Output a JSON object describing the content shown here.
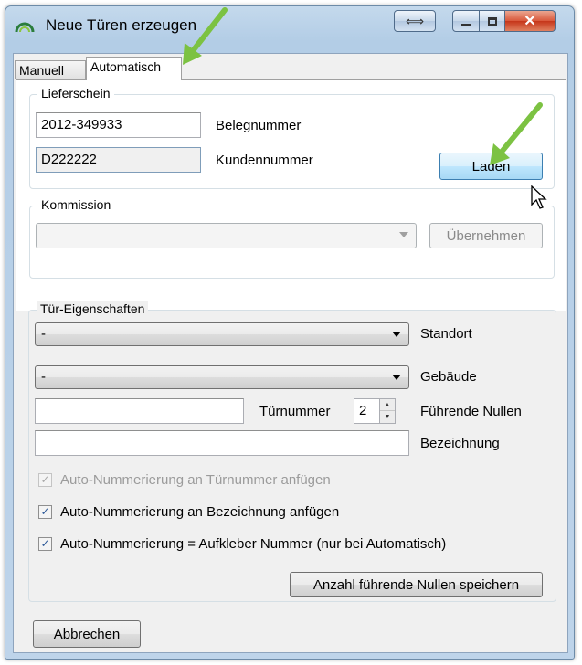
{
  "window": {
    "title": "Neue Türen erzeugen"
  },
  "tabs": [
    {
      "label": "Manuell",
      "selected": false
    },
    {
      "label": "Automatisch",
      "selected": true
    }
  ],
  "lieferschein": {
    "legend": "Lieferschein",
    "beleg_value": "2012-349933",
    "beleg_label": "Belegnummer",
    "kunden_value": "D222222",
    "kunden_label": "Kundennummer",
    "load_button": "Laden"
  },
  "kommission": {
    "legend": "Kommission",
    "selected": "",
    "apply_button": "Übernehmen"
  },
  "tuer": {
    "legend": "Tür-Eigenschaften",
    "standort_value": "-",
    "standort_label": "Standort",
    "gebaeude_value": "-",
    "gebaeude_label": "Gebäude",
    "tuernummer_value": "",
    "tuernummer_label": "Türnummer",
    "nullen_value": "2",
    "nullen_label": "Führende Nullen",
    "bezeichnung_value": "",
    "bezeichnung_label": "Bezeichnung",
    "checks": [
      {
        "label": "Auto-Nummerierung an Türnummer anfügen",
        "checked": true,
        "enabled": false
      },
      {
        "label": "Auto-Nummerierung an Bezeichnung anfügen",
        "checked": true,
        "enabled": true
      },
      {
        "label": "Auto-Nummerierung = Aufkleber Nummer (nur bei Automatisch)",
        "checked": true,
        "enabled": true
      }
    ],
    "save_button": "Anzahl führende Nullen speichern"
  },
  "cancel_button": "Abbrechen",
  "colors": {
    "accent_arrow": "#7cc242",
    "hot_button_border": "#3c7fb1",
    "close_red": "#c6361a"
  }
}
